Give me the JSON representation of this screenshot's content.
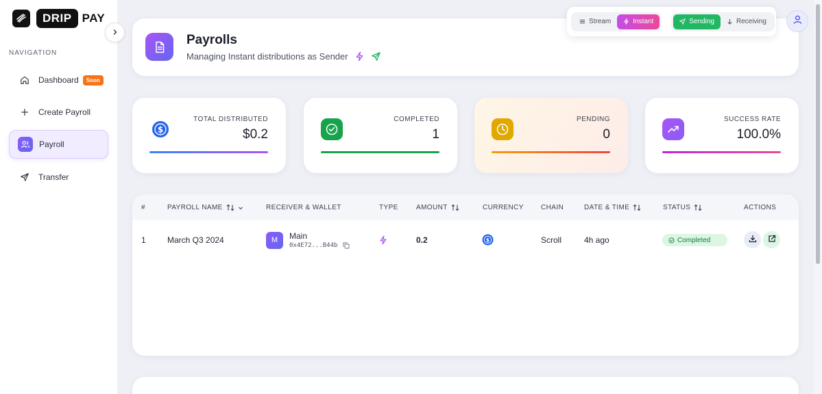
{
  "brand": {
    "drip": "DRIP",
    "pay": "PAY"
  },
  "sidebar": {
    "section_title": "NAVIGATION",
    "items": [
      {
        "label": "Dashboard",
        "icon": "home-icon",
        "badge": "Soon"
      },
      {
        "label": "Create Payroll",
        "icon": "plus-icon"
      },
      {
        "label": "Payroll",
        "icon": "users-icon",
        "active": true
      },
      {
        "label": "Transfer",
        "icon": "send-icon"
      }
    ]
  },
  "header": {
    "title": "Payrolls",
    "subtitle": "Managing Instant distributions as Sender",
    "icon": "document-icon"
  },
  "mode_switch": {
    "type_options": [
      {
        "label": "Stream",
        "icon": "stream-icon",
        "selected": false
      },
      {
        "label": "Instant",
        "icon": "bolt-icon",
        "selected": true
      }
    ],
    "direction_options": [
      {
        "label": "Sending",
        "icon": "send-icon",
        "selected": true
      },
      {
        "label": "Receiving",
        "icon": "arrow-down-icon",
        "selected": false
      }
    ]
  },
  "stats": [
    {
      "label": "TOTAL DISTRIBUTED",
      "value": "$0.2",
      "icon": "dollar-coin-icon",
      "color": "#2563eb"
    },
    {
      "label": "COMPLETED",
      "value": "1",
      "icon": "check-circle-icon",
      "color": "#16a34a"
    },
    {
      "label": "PENDING",
      "value": "0",
      "icon": "clock-icon",
      "color": "#eab308"
    },
    {
      "label": "SUCCESS RATE",
      "value": "100.0%",
      "icon": "trend-up-icon",
      "color": "#a855f7"
    }
  ],
  "table": {
    "columns": [
      "#",
      "PAYROLL NAME",
      "RECEIVER & WALLET",
      "TYPE",
      "AMOUNT",
      "CURRENCY",
      "CHAIN",
      "DATE & TIME",
      "STATUS",
      "ACTIONS"
    ],
    "rows": [
      {
        "index": "1",
        "name": "March Q3 2024",
        "receiver_initial": "M",
        "receiver_name": "Main",
        "wallet": "0x4E72...B44b",
        "type_icon": "bolt-icon",
        "amount": "0.2",
        "currency_icon": "usdc-icon",
        "chain": "Scroll",
        "time": "4h ago",
        "status": "Completed"
      }
    ]
  },
  "colors": {
    "accent_purple": "#8b5cf6",
    "instant_pink": "#ec4899",
    "sending_green": "#22b863",
    "completed_bg": "#dcf5e4"
  }
}
